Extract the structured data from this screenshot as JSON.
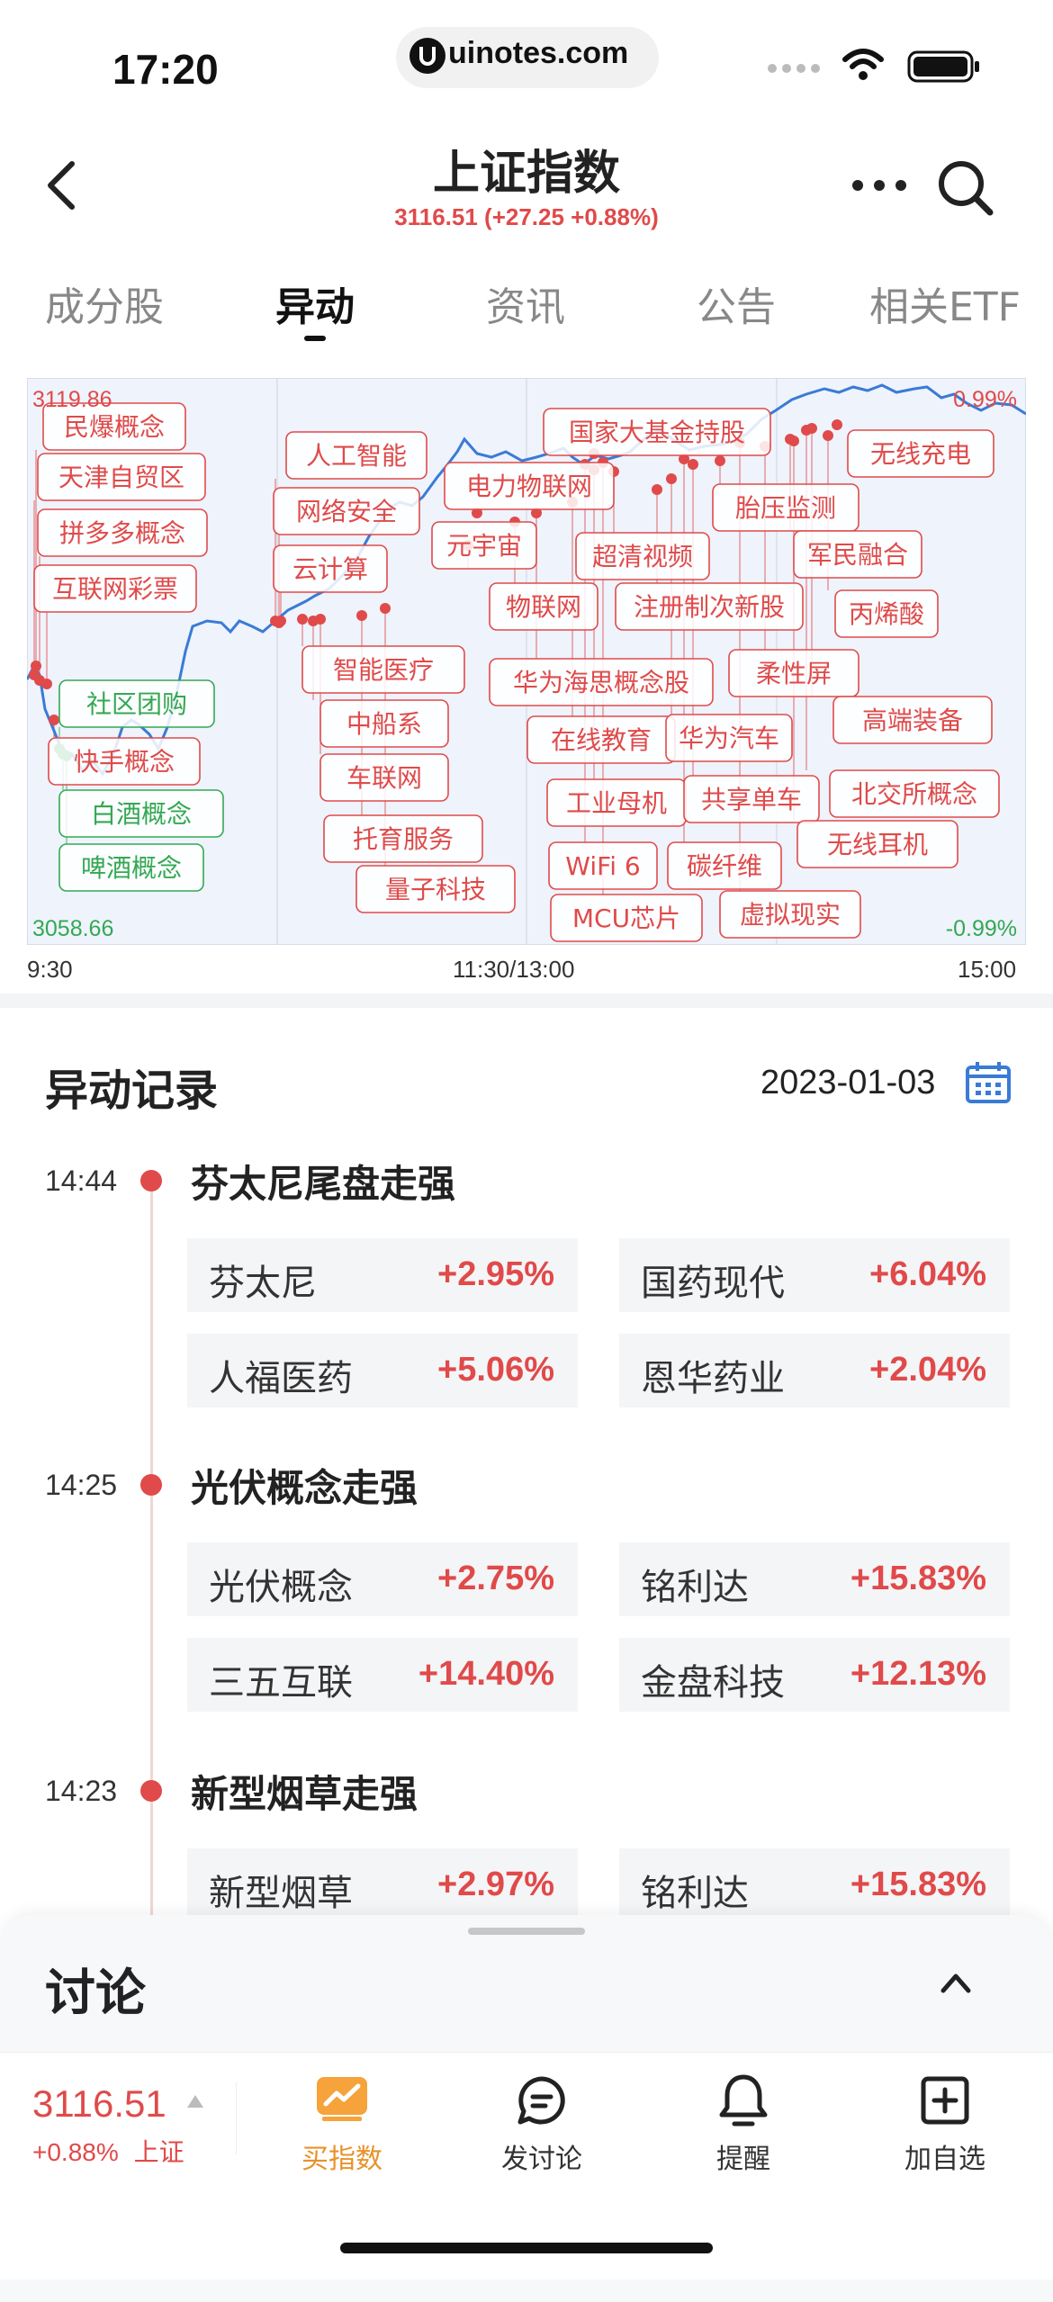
{
  "status_bar": {
    "time": "17:20",
    "url": "uinotes.com"
  },
  "header": {
    "title": "上证指数",
    "subtitle": "3116.51 (+27.25 +0.88%)"
  },
  "tabs": [
    {
      "label": "成分股"
    },
    {
      "label": "异动"
    },
    {
      "label": "资讯"
    },
    {
      "label": "公告"
    },
    {
      "label": "相关ETF"
    }
  ],
  "chart_data": {
    "type": "line",
    "y_high_label": "3119.86",
    "y_low_label": "3058.66",
    "pct_high_label": "0.99%",
    "pct_low_label": "-0.99%",
    "x_labels": [
      "9:30",
      "11:30/13:00",
      "15:00"
    ],
    "ylim": [
      3058.66,
      3119.86
    ],
    "series_color": "#3a7bd5",
    "annotation_red_color": "#e04a4a",
    "annotation_green_color": "#34a853",
    "red_annotations": [
      "民爆概念",
      "天津自贸区",
      "拼多多概念",
      "互联网彩票",
      "快手概念",
      "人工智能",
      "网络安全",
      "云计算",
      "智能医疗",
      "中船系",
      "车联网",
      "托育服务",
      "量子科技",
      "元宇宙",
      "电力物联网",
      "物联网",
      "国家大基金持股",
      "超清视频",
      "注册制次新股",
      "华为海思概念股",
      "在线教育",
      "华为汽车",
      "工业母机",
      "共享单车",
      "WiFi 6",
      "碳纤维",
      "MCU芯片",
      "虚拟现实",
      "胎压监测",
      "军民融合",
      "柔性屏",
      "无线充电",
      "丙烯酸",
      "高端装备",
      "北交所概念",
      "无线耳机"
    ],
    "green_annotations": [
      "社区团购",
      "白酒概念",
      "啤酒概念"
    ]
  },
  "records": {
    "title": "异动记录",
    "date": "2023-01-03",
    "events": [
      {
        "time": "14:44",
        "title": "芬太尼尾盘走强",
        "items": [
          {
            "name": "芬太尼",
            "pct": "+2.95%"
          },
          {
            "name": "国药现代",
            "pct": "+6.04%"
          },
          {
            "name": "人福医药",
            "pct": "+5.06%"
          },
          {
            "name": "恩华药业",
            "pct": "+2.04%"
          }
        ]
      },
      {
        "time": "14:25",
        "title": "光伏概念走强",
        "items": [
          {
            "name": "光伏概念",
            "pct": "+2.75%"
          },
          {
            "name": "铭利达",
            "pct": "+15.83%"
          },
          {
            "name": "三五互联",
            "pct": "+14.40%"
          },
          {
            "name": "金盘科技",
            "pct": "+12.13%"
          }
        ]
      },
      {
        "time": "14:23",
        "title": "新型烟草走强",
        "items": [
          {
            "name": "新型烟草",
            "pct": "+2.97%"
          },
          {
            "name": "铭利达",
            "pct": "+15.83%"
          }
        ]
      }
    ]
  },
  "discussion": {
    "title": "讨论"
  },
  "bottom_bar": {
    "price": "3116.51",
    "change": "+0.88%",
    "index_name": "上证",
    "actions": [
      {
        "label": "买指数",
        "icon": "trend-chart-icon"
      },
      {
        "label": "发讨论",
        "icon": "comment-icon"
      },
      {
        "label": "提醒",
        "icon": "bell-icon"
      },
      {
        "label": "加自选",
        "icon": "add-box-icon"
      }
    ]
  }
}
